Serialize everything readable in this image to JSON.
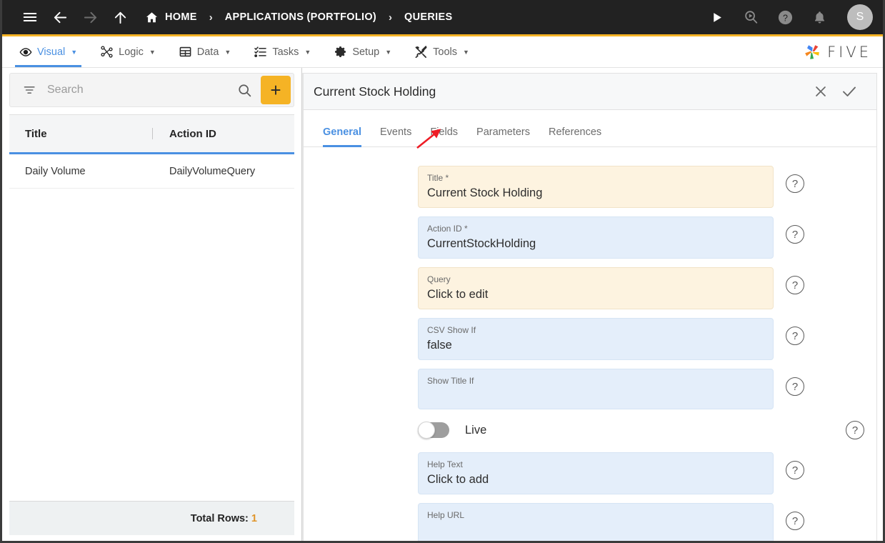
{
  "topbar": {
    "menu_icon": "hamburger-icon",
    "back_icon": "arrow-left-icon",
    "forward_icon": "arrow-right-icon",
    "up_icon": "arrow-up-icon",
    "home_icon": "home-icon",
    "breadcrumbs": [
      {
        "label": "HOME"
      },
      {
        "label": "APPLICATIONS (PORTFOLIO)"
      },
      {
        "label": "QUERIES"
      }
    ],
    "separator": "›",
    "actions": [
      {
        "name": "run-icon",
        "glyph": "▶"
      },
      {
        "name": "search-run-icon",
        "glyph": "⌕"
      },
      {
        "name": "help-icon",
        "glyph": "?"
      },
      {
        "name": "notifications-bell-icon",
        "glyph": "🔔"
      }
    ],
    "avatar_initial": "S",
    "background": "#222222",
    "accent": "#f5b325"
  },
  "menubar": {
    "items": [
      {
        "label": "Visual",
        "icon": "eye-icon",
        "active": true
      },
      {
        "label": "Logic",
        "icon": "logic-nodes-icon",
        "active": false
      },
      {
        "label": "Data",
        "icon": "table-grid-icon",
        "active": false
      },
      {
        "label": "Tasks",
        "icon": "checklist-icon",
        "active": false
      },
      {
        "label": "Setup",
        "icon": "gear-icon",
        "active": false
      },
      {
        "label": "Tools",
        "icon": "tools-icon",
        "active": false
      }
    ],
    "caret": "▼",
    "brand": "FIVE",
    "active_color": "#4a90e2"
  },
  "sidebar": {
    "search": {
      "placeholder": "Search",
      "value": ""
    },
    "filter_icon": "filter-icon",
    "search_icon": "search-icon",
    "add_label": "+",
    "columns": [
      "Title",
      "Action ID"
    ],
    "rows": [
      {
        "title": "Daily Volume",
        "action_id": "DailyVolumeQuery"
      }
    ],
    "footer": {
      "label": "Total Rows:",
      "count": "1"
    }
  },
  "panel": {
    "title": "Current Stock Holding",
    "close_icon": "close-icon",
    "confirm_icon": "check-icon",
    "tabs": [
      {
        "label": "General",
        "active": true
      },
      {
        "label": "Events",
        "active": false
      },
      {
        "label": "Fields",
        "active": false
      },
      {
        "label": "Parameters",
        "active": false
      },
      {
        "label": "References",
        "active": false
      }
    ],
    "fields": [
      {
        "label": "Title *",
        "value": "Current Stock Holding",
        "style": "cream",
        "empty": false
      },
      {
        "label": "Action ID *",
        "value": "CurrentStockHolding",
        "style": "blue",
        "empty": false
      },
      {
        "label": "Query",
        "value": "Click to edit",
        "style": "cream",
        "empty": false
      },
      {
        "label": "CSV Show If",
        "value": "false",
        "style": "blue",
        "empty": false
      },
      {
        "label": "Show Title If",
        "value": "",
        "style": "blue",
        "empty": true
      }
    ],
    "toggle": {
      "label": "Live",
      "on": false
    },
    "fields_after_toggle": [
      {
        "label": "Help Text",
        "value": "Click to add",
        "style": "blue",
        "empty": false
      },
      {
        "label": "Help URL",
        "value": "",
        "style": "blue",
        "empty": true
      }
    ],
    "help_glyph": "?",
    "colors": {
      "cream": "#fdf3e0",
      "blue": "#e4eefa"
    }
  },
  "annotation": {
    "type": "arrow",
    "color": "#ee1c25",
    "points_to": "Fields"
  }
}
